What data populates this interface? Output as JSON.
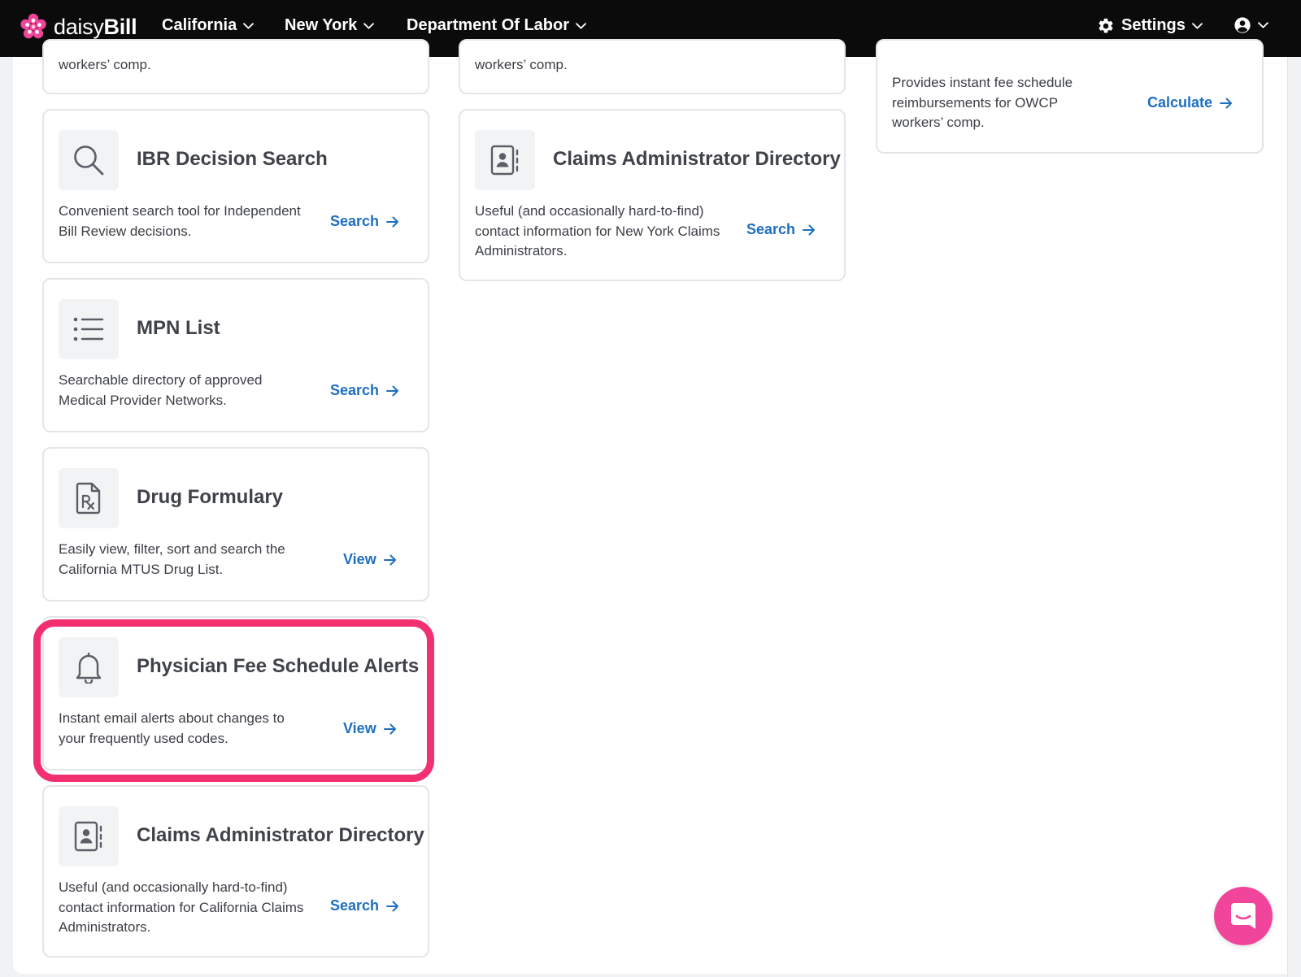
{
  "nav": {
    "brand_light": "daisy",
    "brand_bold": "Bill",
    "menu_california": "California",
    "menu_new_york": "New York",
    "menu_dol": "Department Of Labor",
    "menu_settings": "Settings"
  },
  "cards": {
    "top_left_partial": {
      "desc_line": "workers’ comp."
    },
    "top_mid_partial": {
      "desc_line": "workers’ comp."
    },
    "owcp_fee_calculator": {
      "desc": "Provides instant fee schedule reimbursements for OWCP workers’ comp.",
      "link": "Calculate"
    },
    "ibr_search": {
      "title": "IBR Decision Search",
      "desc": "Convenient search tool for Independent Bill Review decisions.",
      "link": "Search"
    },
    "ny_claims_admin": {
      "title": "Claims Administrator Directory",
      "desc": "Useful (and occasionally hard-to-find) contact information for New York Claims Administrators.",
      "link": "Search"
    },
    "mpn_list": {
      "title": "MPN List",
      "desc": "Searchable directory of approved Medical Provider Networks.",
      "link": "Search"
    },
    "drug_formulary": {
      "title": "Drug Formulary",
      "desc": "Easily view, filter, sort and search the California MTUS Drug List.",
      "link": "View"
    },
    "fee_schedule_alerts": {
      "title": "Physician Fee Schedule Alerts",
      "desc": "Instant email alerts about changes to your frequently used codes.",
      "link": "View"
    },
    "ca_claims_admin": {
      "title": "Claims Administrator Directory",
      "desc": "Useful (and occasionally hard-to-find) contact information for California Claims Administrators.",
      "link": "Search"
    }
  },
  "colors": {
    "nav_bg": "#0b0b0b",
    "link": "#1d6fc1",
    "highlight": "#f2306f",
    "chat": "#f0459a"
  },
  "icons": {
    "ibr_search": "magnifier-icon",
    "claims_admin": "contact-book-icon",
    "mpn_list": "list-icon",
    "drug_formulary": "rx-document-icon",
    "fee_schedule_alerts": "bell-icon",
    "chat": "chat-bubble-icon"
  }
}
